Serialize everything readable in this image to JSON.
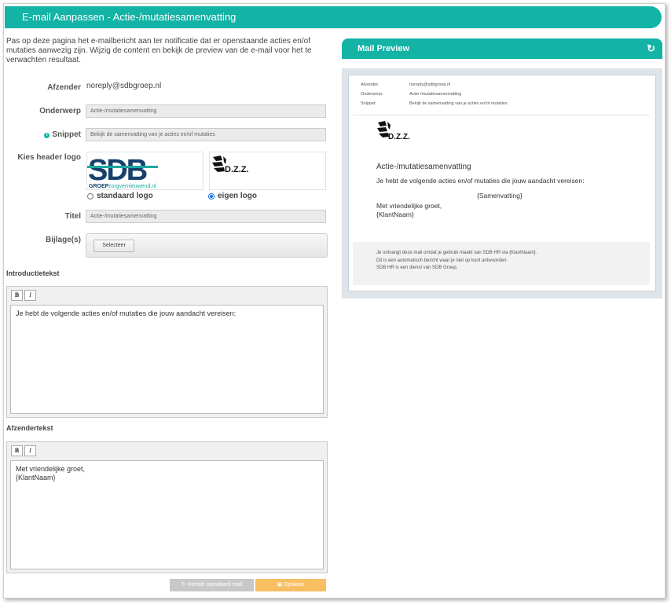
{
  "window": {
    "title": "E-mail Aanpassen - Actie-/mutatiesamenvatting"
  },
  "intro_text": "Pas op deze pagina het e-mailbericht aan ter notificatie dat er openstaande acties en/of mutaties aanwezig zijn. Wijzig de content en bekijk de preview van de e-mail voor het te verwachten resultaat.",
  "form": {
    "afzender_label": "Afzender",
    "afzender_value": "noreply@sdbgroep.nl",
    "onderwerp_label": "Onderwerp",
    "onderwerp_value": "Actie-/mutatiesamenvatting",
    "snippet_label": "Snippet",
    "snippet_value": "Bekijk de samenvatting van je acties en/of mutaties",
    "logo_label": "Kies header logo",
    "logo_options": [
      {
        "label": "standaard logo",
        "selected": false,
        "logo_text": "SDB",
        "logo_subtext": "GROEP",
        "logo_tagline": "zorgvernieuwend.nl"
      },
      {
        "label": "eigen logo",
        "selected": true,
        "logo_text": "D.Z.Z."
      }
    ],
    "titel_label": "Titel",
    "titel_value": "Actie-/mutatiesamenvatting",
    "bijlage_label": "Bijlage(s)",
    "selecteer_label": "Selecteer"
  },
  "introductietekst": {
    "title": "Introductietekst",
    "bold": "B",
    "italic": "I",
    "content": "Je hebt de volgende acties en/of mutaties die jouw aandacht vereisen:"
  },
  "afzendertekst": {
    "title": "Afzendertekst",
    "bold": "B",
    "italic": "I",
    "content": "Met vriendelijke groet,\n{KlantNaam}"
  },
  "buttons": {
    "herstel": "Herstel standaard mail",
    "opslaan": "Opslaan"
  },
  "preview": {
    "title": "Mail Preview",
    "header_rows": [
      {
        "key": "Afzender:",
        "value": "noreply@sdbgroep.nl"
      },
      {
        "key": "Onderwerp:",
        "value": "Actie-/mutatiesamenvatting"
      },
      {
        "key": "Snippet:",
        "value": "Bekijk de samenvatting van je acties en/of mutaties"
      }
    ],
    "logo_text": "D.Z.Z.",
    "heading": "Actie-/mutatiesamenvatting",
    "intro": "Je hebt de volgende acties en/of mutaties die jouw aandacht vereisen:",
    "summary": "{Samenvatting}",
    "greeting": "Met vriendelijke groet,",
    "client": "{KlantNaam}",
    "footer": [
      "Je ontvangt deze mail omdat je gebruik maakt van SDB HR via {KlantNaam}.",
      "Dit is een automatisch bericht waar je niet op kunt antwoorden.",
      "SDB HR is een dienst van SDB Groep."
    ]
  },
  "colors": {
    "accent": "#13b3a6",
    "save_button": "#f7be62",
    "restore_button": "#c8c8c8",
    "sdb_dark": "#17406b",
    "sdb_teal": "#1aa9a2"
  },
  "icons": {
    "info": "info-icon",
    "refresh": "refresh-icon",
    "save": "save-icon",
    "restore": "restore-icon"
  }
}
